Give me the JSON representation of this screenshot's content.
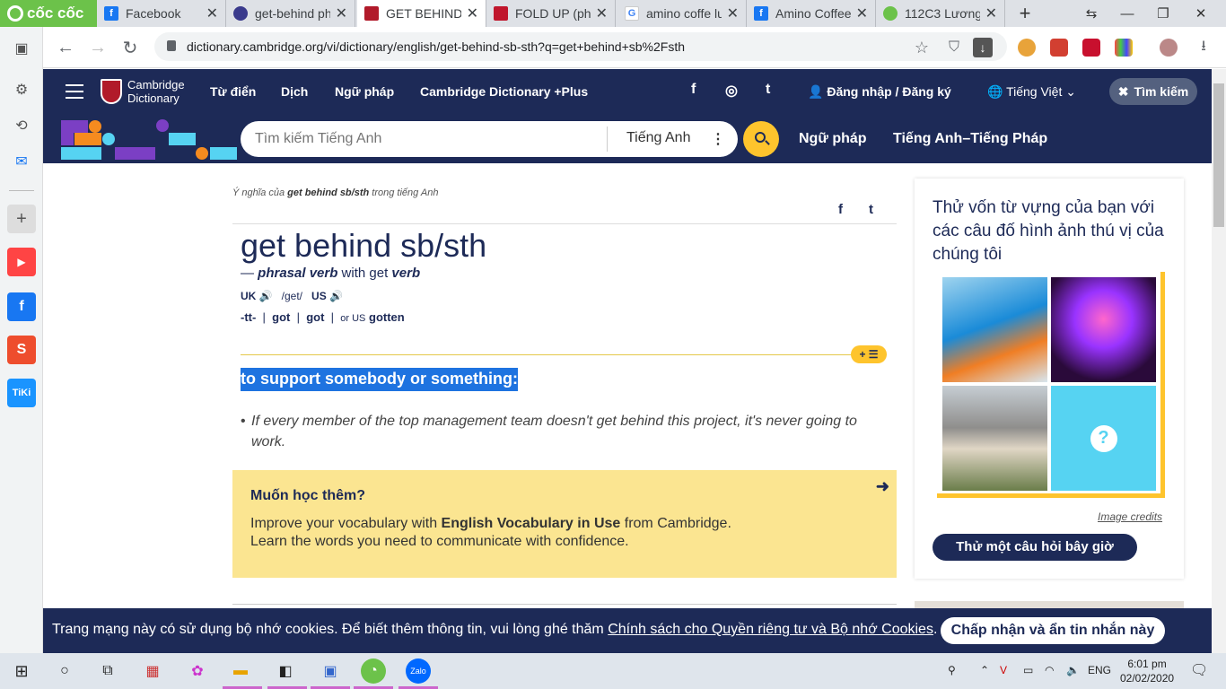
{
  "browser": {
    "brand": "cốc cốc",
    "tabs": [
      {
        "title": "Facebook",
        "fav_color": "#1877f2"
      },
      {
        "title": "get-behind ph",
        "fav_color": "#3a3a8c"
      },
      {
        "title": "GET BEHIND S",
        "fav_color": "#b11a2a"
      },
      {
        "title": "FOLD UP (phra",
        "fav_color": "#c0162c"
      },
      {
        "title": "amino coffe lu",
        "fav_color": "#4285f4"
      },
      {
        "title": "Amino Coffee",
        "fav_color": "#1877f2"
      },
      {
        "title": "112C3 Lương",
        "fav_color": "#6cc24a"
      }
    ],
    "url": "dictionary.cambridge.org/vi/dictionary/english/get-behind-sb-sth?q=get+behind+sb%2Fsth"
  },
  "site": {
    "logo_line1": "Cambridge",
    "logo_line2": "Dictionary",
    "nav": [
      "Từ điển",
      "Dịch",
      "Ngữ pháp",
      "Cambridge Dictionary +Plus"
    ],
    "social": [
      "f",
      "◎",
      "t"
    ],
    "login": "Đăng nhập / Đăng ký",
    "language": "Tiếng Việt",
    "search_pill": "Tìm kiếm",
    "search_placeholder": "Tìm kiếm Tiếng Anh",
    "search_lang": "Tiếng Anh",
    "band_links": [
      "Ngữ pháp",
      "Tiếng Anh–Tiếng Pháp"
    ]
  },
  "entry": {
    "crumb_pre": "Ý nghĩa của ",
    "crumb_term": "get behind sb/sth",
    "crumb_post": " trong tiếng Anh",
    "headword": "get behind sb/sth",
    "pos_dash": "— ",
    "pos_main": "phrasal verb",
    "pos_with": " with get ",
    "pos_verb": "verb",
    "uk": "UK",
    "ipa": "/get/",
    "us": "US",
    "forms": [
      "-tt-",
      "got",
      "got",
      "gotten"
    ],
    "forms_or_us": "or US",
    "addlist": "+ ☰",
    "definition": "to support somebody or something:",
    "example": "If every member of the top management team doesn't get behind this project, it's never going to work."
  },
  "promo": {
    "title": "Muốn học thêm?",
    "line1_pre": "Improve your vocabulary with ",
    "line1_bold": "English Vocabulary in Use",
    "line1_post": " from Cambridge.",
    "line2": "Learn the words you need to communicate with confidence."
  },
  "quiz": {
    "title": "Thử vốn từ vựng của bạn với các câu đố hình ảnh thú vị của chúng tôi",
    "credits": "Image credits",
    "button": "Thử một câu hỏi bây giờ",
    "question_mark": "?"
  },
  "cookie": {
    "text_pre": "Trang mạng này có sử dụng bộ nhớ cookies. Để biết thêm thông tin, vui lòng ghé thăm ",
    "link": "Chính sách cho Quyền riêng tư và Bộ nhớ Cookies",
    "text_post": ".",
    "button": "Chấp nhận và ẩn tin nhắn này"
  },
  "taskbar": {
    "lang": "ENG",
    "time": "6:01 pm",
    "date": "02/02/2020"
  },
  "colors": {
    "cambridge_navy": "#1d2a57",
    "accent_yellow": "#fec42d",
    "highlight_blue": "#1e73e0"
  }
}
